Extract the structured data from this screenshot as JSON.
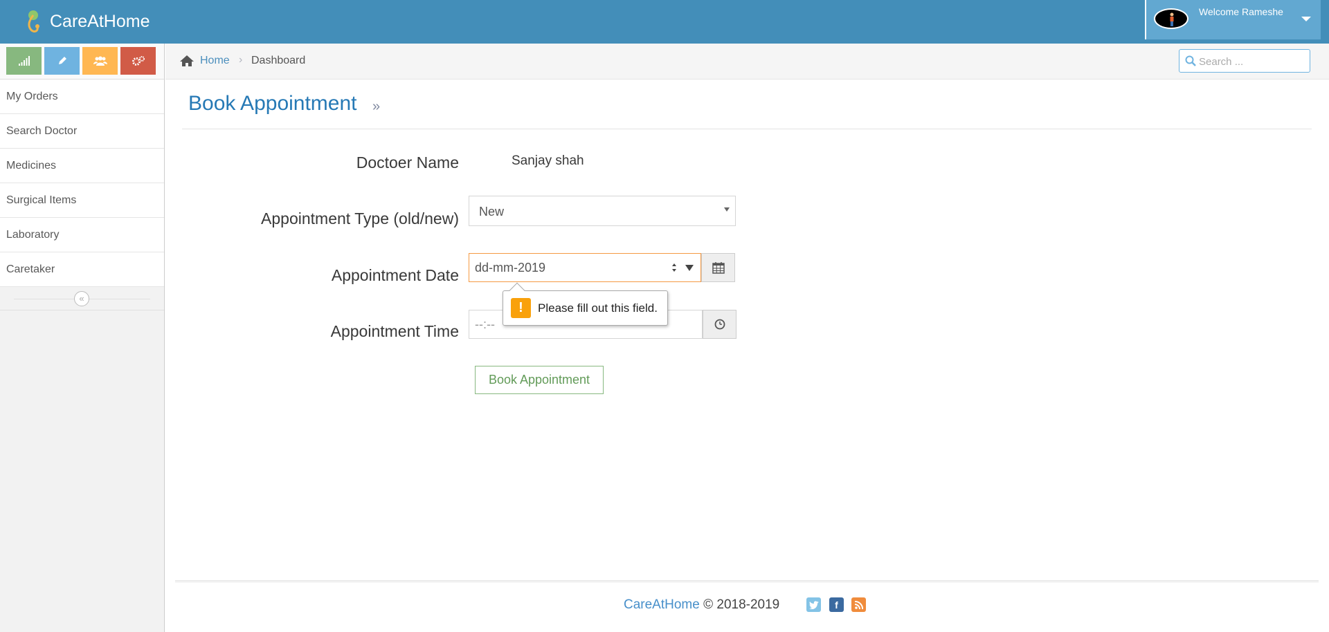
{
  "navbar": {
    "brand": "CareAtHome",
    "welcome": "Welcome Rameshe"
  },
  "sidebar": {
    "shortcuts": [
      {
        "icon": "signal-icon",
        "color": "#87b87f"
      },
      {
        "icon": "pencil-icon",
        "color": "#6fb3e0"
      },
      {
        "icon": "users-icon",
        "color": "#ffb752"
      },
      {
        "icon": "cogs-icon",
        "color": "#d15b47"
      }
    ],
    "items": [
      {
        "label": "My Orders"
      },
      {
        "label": "Search Doctor"
      },
      {
        "label": "Medicines"
      },
      {
        "label": "Surgical Items"
      },
      {
        "label": "Laboratory"
      },
      {
        "label": "Caretaker"
      }
    ]
  },
  "breadcrumb": {
    "home": "Home",
    "current": "Dashboard",
    "search_placeholder": "Search ..."
  },
  "page": {
    "title": "Book Appointment",
    "chevron": "»"
  },
  "form": {
    "doctor_label": "Doctoer Name",
    "doctor_value": "Sanjay shah",
    "type_label": "Appointment Type (old/new)",
    "type_value": "New",
    "date_label": "Appointment Date",
    "date_value": "dd-mm-2019",
    "time_label": "Appointment Time",
    "time_value": "--:--",
    "submit_label": "Book Appointment"
  },
  "validation": {
    "message": "Please fill out this field."
  },
  "footer": {
    "brand": "CareAtHome",
    "copyright": "© 2018-2019"
  },
  "colors": {
    "navbar": "#438eb9",
    "accent": "#2679b5",
    "warning": "#f9a10b"
  }
}
